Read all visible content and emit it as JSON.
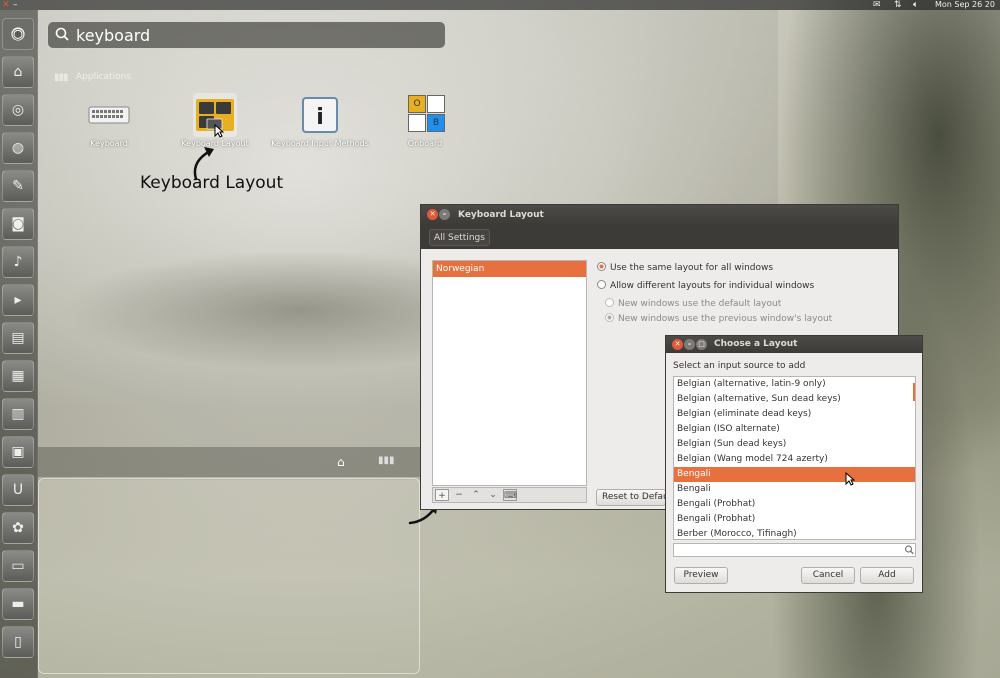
{
  "top_panel": {
    "clock": "Mon Sep 26 20",
    "icons": [
      "mail-icon",
      "network-icon",
      "volume-icon"
    ]
  },
  "launcher": {
    "items": [
      "ubuntu-bfb-icon",
      "home-folder-icon",
      "chromium-icon",
      "firefox-icon",
      "text-editor-icon",
      "camera-icon",
      "microphone-icon",
      "terminal-icon",
      "writer-icon",
      "calc-icon",
      "impress-icon",
      "software-center-icon",
      "ubuntu-one-icon",
      "gimp-icon",
      "workspace-switcher-icon",
      "screen-icon",
      "trash-icon"
    ]
  },
  "dash": {
    "search_value": "keyboard",
    "apps_heading": "Applications",
    "apps": [
      {
        "label": "Keyboard"
      },
      {
        "label": "Keyboard Layout"
      },
      {
        "label": "Keyboard Input Methods"
      },
      {
        "label": "Onboard"
      }
    ],
    "onboard_keys": [
      "O",
      "B"
    ]
  },
  "annotation": {
    "label": "Keyboard Layout"
  },
  "keyboard_layout_window": {
    "title": "Keyboard Layout",
    "all_settings": "All Settings",
    "layouts": [
      "Norwegian"
    ],
    "list_buttons": [
      "+",
      "−",
      "⌃",
      "⌄",
      "⌨"
    ],
    "options": [
      {
        "label": "Use the same layout for all windows",
        "checked": true,
        "enabled": true
      },
      {
        "label": "Allow different layouts for individual windows",
        "checked": false,
        "enabled": true
      },
      {
        "label": "New windows use the default layout",
        "checked": false,
        "enabled": false
      },
      {
        "label": "New windows use the previous window's layout",
        "checked": true,
        "enabled": false
      }
    ],
    "reset_button": "Reset to Defaults"
  },
  "choose_layout_dialog": {
    "title": "Choose a Layout",
    "subtitle": "Select an input source to add",
    "items": [
      "Belgian (alternative, latin-9 only)",
      "Belgian (alternative, Sun dead keys)",
      "Belgian (eliminate dead keys)",
      "Belgian (ISO alternate)",
      "Belgian (Sun dead keys)",
      "Belgian (Wang model 724 azerty)",
      "Bengali",
      "Bengali",
      "Bengali (Probhat)",
      "Bengali (Probhat)",
      "Berber (Morocco, Tifinagh)"
    ],
    "selected_index": 6,
    "search_value": "",
    "preview_button": "Preview",
    "cancel_button": "Cancel",
    "add_button": "Add"
  },
  "colors": {
    "accent": "#e6713f",
    "titlebar": "#3c3b37"
  }
}
